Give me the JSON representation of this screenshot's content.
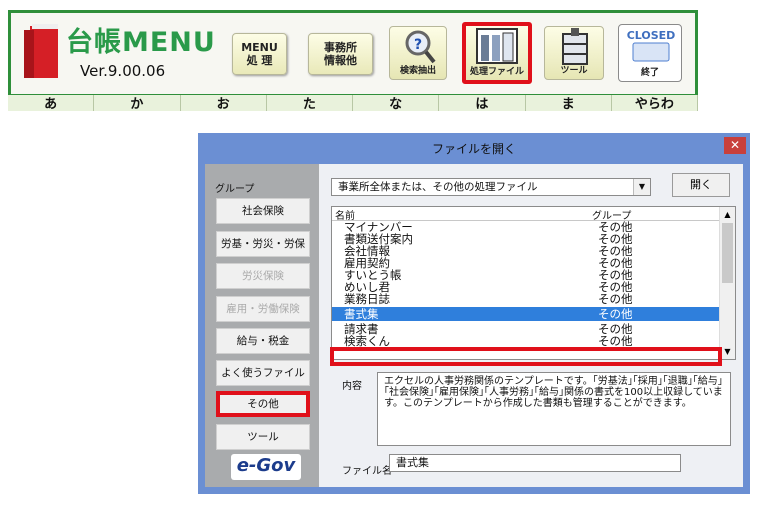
{
  "app": {
    "title": "台帳MENU",
    "version": "Ver.9.00.06",
    "buttons": {
      "menu": "MENU\n処 理",
      "office": "事務所\n情報他",
      "search": "検索抽出",
      "process": "処理ファイル",
      "tool": "ツール",
      "closed": "終了",
      "closed_sign": "CLOSED"
    },
    "kana": [
      "あ",
      "か",
      "お",
      "た",
      "な",
      "は",
      "ま",
      "やらわ"
    ]
  },
  "dialog": {
    "title": "ファイルを開く",
    "close": "✕",
    "group_label": "グループ",
    "groups": [
      {
        "label": "社会保険",
        "enabled": true
      },
      {
        "label": "労基・労災・労保",
        "enabled": true
      },
      {
        "label": "労災保険",
        "enabled": false
      },
      {
        "label": "雇用・労働保険",
        "enabled": false
      },
      {
        "label": "給与・税金",
        "enabled": true
      },
      {
        "label": "よく使うファイル",
        "enabled": true
      },
      {
        "label": "その他",
        "enabled": true
      },
      {
        "label": "ツール",
        "enabled": true
      }
    ],
    "egov": "e-Gov",
    "combo_value": "事業所全体または、その他の処理ファイル",
    "combo_arrow": "▼",
    "open_button": "開く",
    "list_headers": {
      "name": "名前",
      "group": "グループ"
    },
    "rows": [
      {
        "name": "マイナンバー",
        "group": "その他"
      },
      {
        "name": "書類送付案内",
        "group": "その他"
      },
      {
        "name": "会社情報",
        "group": "その他"
      },
      {
        "name": "雇用契約",
        "group": "その他"
      },
      {
        "name": "すいとう帳",
        "group": "その他"
      },
      {
        "name": "めいし君",
        "group": "その他"
      },
      {
        "name": "業務日誌",
        "group": "その他"
      },
      {
        "name": "書式集",
        "group": "その他",
        "selected": true
      },
      {
        "name": "請求書",
        "group": "その他"
      },
      {
        "name": "検索くん",
        "group": "その他"
      }
    ],
    "scroll_up": "▲",
    "scroll_down": "▼",
    "content_label": "内容",
    "content_text": "エクセルの人事労務関係のテンプレートです。｢労基法｣｢採用｣｢退職｣｢給与｣｢社会保険｣｢雇用保険｣｢人事労務｣｢給与｣関係の書式を100以上収録しています。このテンプレートから作成した書類も管理することができます。",
    "filename_label": "ファイル名",
    "filename_value": "書式集"
  },
  "colors": {
    "frame_green": "#2f8f3a",
    "highlight_red": "#e0101a",
    "dialog_blue": "#6b8fd3",
    "selection_blue": "#2f7fdc"
  }
}
